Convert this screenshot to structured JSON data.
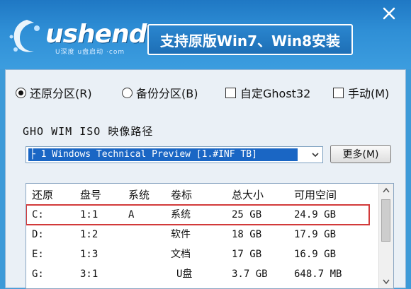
{
  "header": {
    "logo_text": "ushendu",
    "logo_sub": "U深度 u盘启动 ·com",
    "banner_text": "支持原版Win7、Win8安装"
  },
  "options": {
    "restore_label": "还原分区(R)",
    "backup_label": "备份分区(B)",
    "ghost32_label": "自定Ghost32",
    "manual_label": "手动(M)",
    "restore_selected": true,
    "backup_selected": false,
    "ghost32_checked": false,
    "manual_checked": false
  },
  "path": {
    "label": "GHO WIM ISO 映像路径",
    "selected_value": "├ 1 Windows Technical Preview [1.#INF TB]",
    "more_button": "更多(M)"
  },
  "table": {
    "headers": [
      "还原",
      "盘号",
      "系统",
      "卷标",
      "总大小",
      "可用空间"
    ],
    "rows": [
      [
        "C:",
        "1:1",
        "A",
        "系统",
        "25 GB",
        "24.9 GB"
      ],
      [
        "D:",
        "1:2",
        "",
        "软件",
        "18 GB",
        "17.9 GB"
      ],
      [
        "E:",
        "1:3",
        "",
        "文档",
        "17 GB",
        "16.9 GB"
      ],
      [
        "G:",
        "3:1",
        "",
        "U盘",
        "3.7 GB",
        "648.7 MB"
      ]
    ],
    "selected_row": 0
  },
  "colors": {
    "header_blue": "#1f78c4",
    "selection_blue": "#1a66c4",
    "highlight_red": "#d23a3a"
  }
}
